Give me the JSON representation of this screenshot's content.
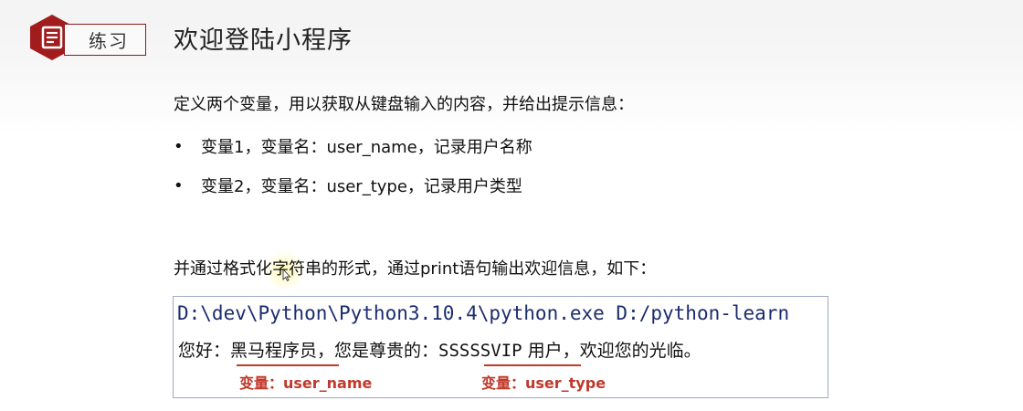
{
  "header": {
    "tag_label": "练习",
    "title": "欢迎登陆小程序",
    "badge_icon": "document-icon",
    "accent_color": "#a11d1d"
  },
  "content": {
    "intro": "定义两个变量，用以获取从键盘输入的内容，并给出提示信息：",
    "bullets": [
      "变量1，变量名：user_name，记录用户名称",
      "变量2，变量名：user_type，记录用户类型"
    ],
    "instruction": "并通过格式化字符串的形式，通过print语句输出欢迎信息，如下："
  },
  "console": {
    "path_line": "D:\\dev\\Python\\Python3.10.4\\python.exe D:/python-learn",
    "output_prefix": "您好：",
    "user_name_value": "黑马程序员",
    "output_middle": "，您是尊贵的：",
    "user_type_value": "SSSSSVIP",
    "output_suffix": " 用户，欢迎您的光临。",
    "label_user_name": "变量：user_name",
    "label_user_type": "变量：user_type",
    "highlight_color": "#c0392b"
  }
}
